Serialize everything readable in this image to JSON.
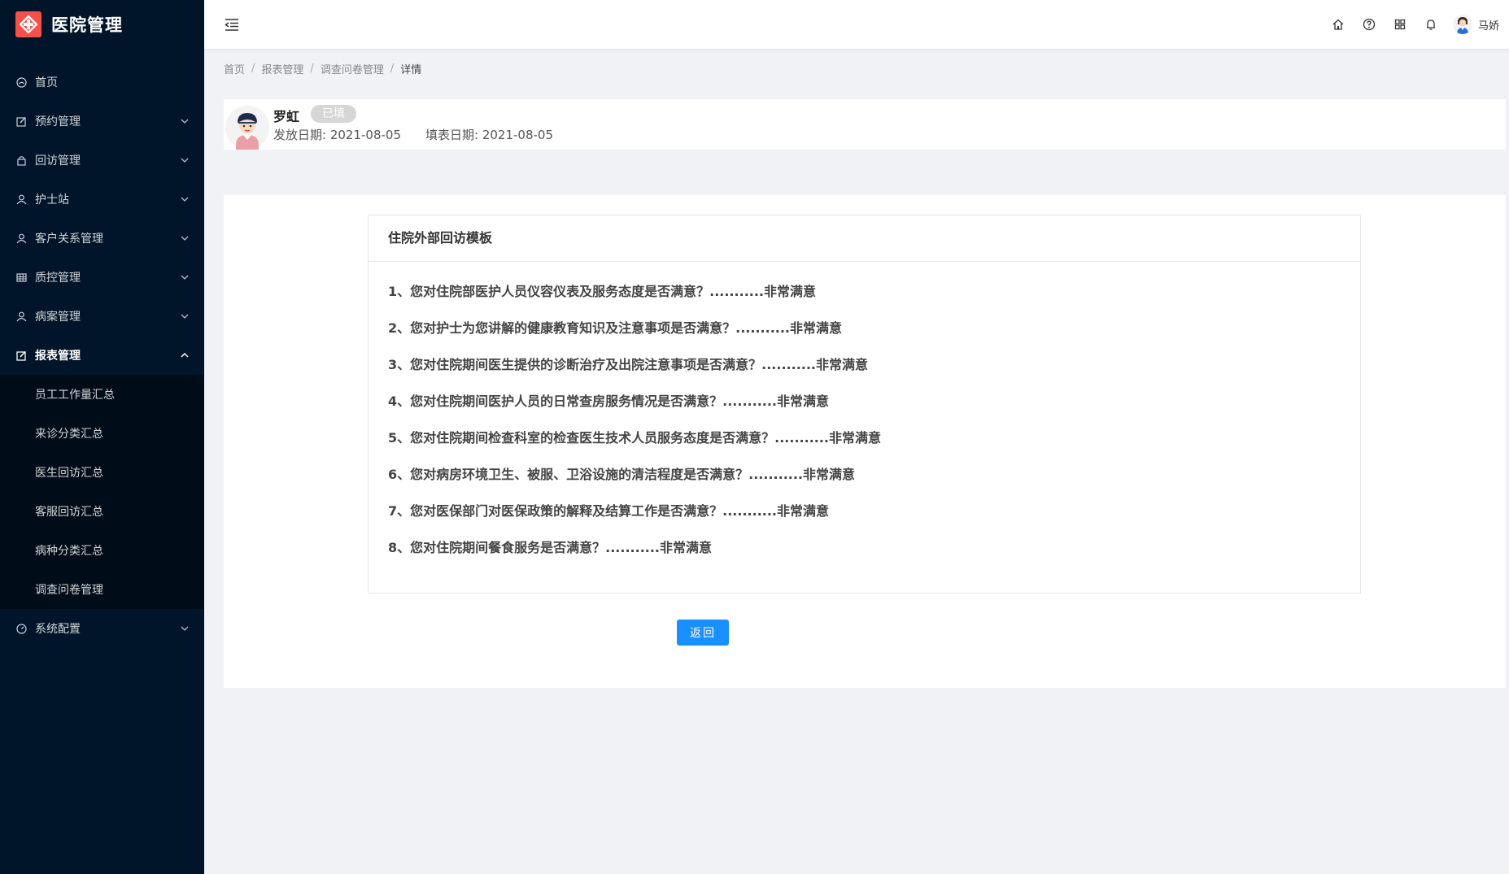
{
  "app": {
    "title": "医院管理"
  },
  "sidebar": {
    "items": [
      {
        "label": "首页",
        "icon": "dashboard-icon"
      },
      {
        "label": "预约管理",
        "icon": "edit-icon"
      },
      {
        "label": "回访管理",
        "icon": "lock-icon"
      },
      {
        "label": "护士站",
        "icon": "user-icon"
      },
      {
        "label": "客户关系管理",
        "icon": "user-icon"
      },
      {
        "label": "质控管理",
        "icon": "table-icon"
      },
      {
        "label": "病案管理",
        "icon": "user-icon"
      },
      {
        "label": "报表管理",
        "icon": "edit-icon"
      }
    ],
    "submenu": [
      {
        "label": "员工工作量汇总"
      },
      {
        "label": "来诊分类汇总"
      },
      {
        "label": "医生回访汇总"
      },
      {
        "label": "客服回访汇总"
      },
      {
        "label": "病种分类汇总"
      },
      {
        "label": "调查问卷管理"
      }
    ],
    "system": {
      "label": "系统配置",
      "icon": "gauge-icon"
    }
  },
  "header": {
    "user_name": "马娇"
  },
  "breadcrumb": [
    "首页",
    "报表管理",
    "调查问卷管理",
    "详情"
  ],
  "profile": {
    "name": "罗虹",
    "status": "已填",
    "issue_date": "发放日期: 2021-08-05",
    "fill_date": "填表日期: 2021-08-05"
  },
  "survey": {
    "title": "住院外部回访模板",
    "questions": [
      {
        "q": "1、您对住院部医护人员仪容仪表及服务态度是否满意？",
        "a": "...........非常满意"
      },
      {
        "q": "2、您对护士为您讲解的健康教育知识及注意事项是否满意？",
        "a": "...........非常满意"
      },
      {
        "q": "3、您对住院期间医生提供的诊断治疗及出院注意事项是否满意？",
        "a": "...........非常满意"
      },
      {
        "q": "4、您对住院期间医护人员的日常查房服务情况是否满意？",
        "a": "...........非常满意"
      },
      {
        "q": "5、您对住院期间检查科室的检查医生技术人员服务态度是否满意？",
        "a": "...........非常满意"
      },
      {
        "q": "6、您对病房环境卫生、被服、卫浴设施的清洁程度是否满意？",
        "a": "...........非常满意"
      },
      {
        "q": "7、您对医保部门对医保政策的解释及结算工作是否满意？",
        "a": "...........非常满意"
      },
      {
        "q": "8、您对住院期间餐食服务是否满意？",
        "a": "...........非常满意"
      }
    ]
  },
  "actions": {
    "back_label": "返回"
  },
  "colors": {
    "sidebar_bg": "#001529",
    "submenu_bg": "#000c17",
    "primary": "#1890ff",
    "logo": "#f5514b"
  }
}
